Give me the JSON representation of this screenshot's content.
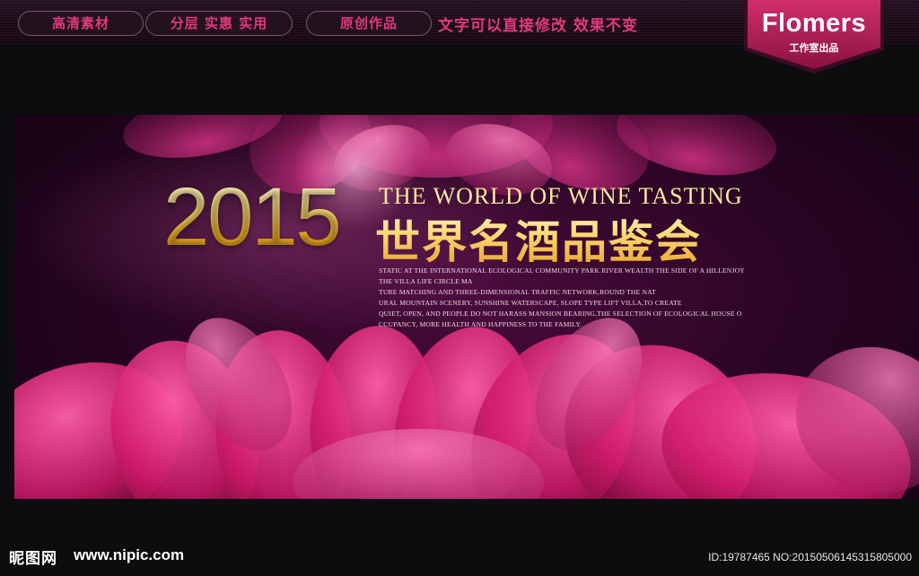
{
  "topbar": {
    "pills": [
      "高清素材",
      "分层 实惠 实用",
      "原创作品"
    ],
    "slogan": "文字可以直接修改  效果不变"
  },
  "brand": {
    "name": "Flomers",
    "subtitle": "工作室出品",
    "color": "#b4205a"
  },
  "banner": {
    "year": "2015",
    "title_en": "THE WORLD OF WINE TASTING",
    "title_cn": "世界名酒品鉴会",
    "description_lines": [
      "STATIC AT THE INTERNATIONAL ECOLOGICAL COMMUNITY PARK RIVER WEALTH THE SIDE OF A HILLENJOY",
      "THE VILLA LIFE CIRCLE MA",
      "TURE MATCHING AND THREE-DIMENSIONAL TRAFFIC NETWORK,ROUND THE NAT",
      "URAL MOUNTAIN SCENERY, SUNSHINE WATERSCAPE, SLOPE TYPE LIFT VILLA,TO CREATE",
      "QUIET, OPEN, AND PEOPLE DO NOT HARASS MANSION BEARING,THE SELECTION OF ECOLOGICAL HOUSE O",
      "CCUPANCY, MORE HEALTH AND HAPPINESS TO THE FAMILY."
    ],
    "colors": {
      "gold": "#f6c63a",
      "magenta": "#e0207a"
    }
  },
  "watermark": {
    "logo_text": "昵图网",
    "url": "www.nipic.com",
    "id_text": "ID:19787465 NO:20150506145315805000"
  }
}
